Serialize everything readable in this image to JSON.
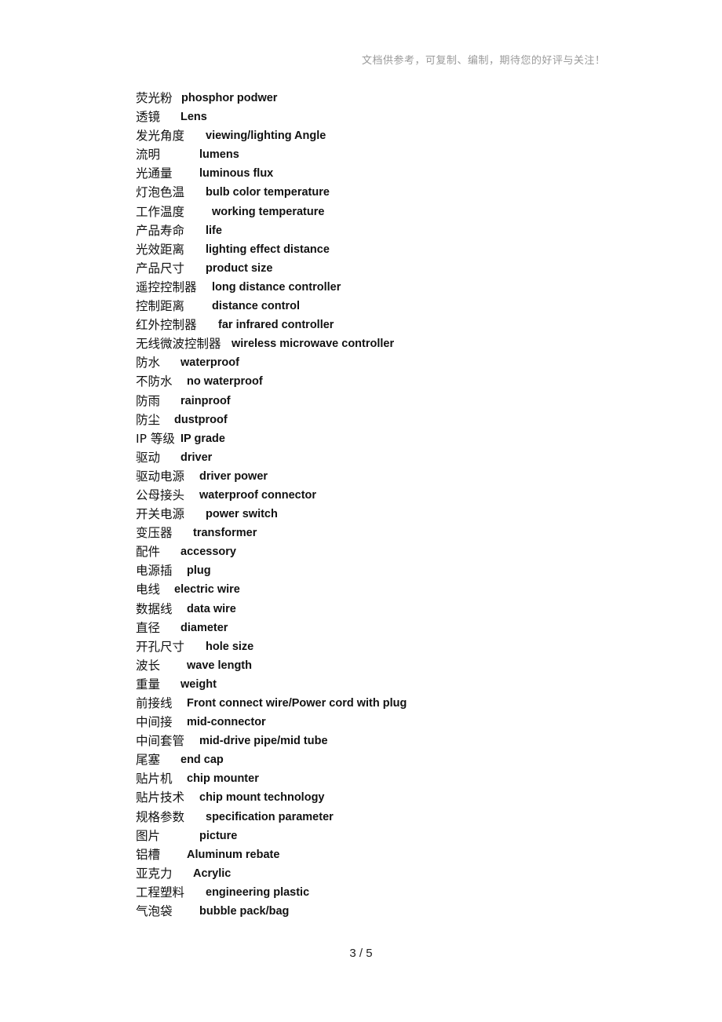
{
  "header_note": "文档供参考，可复制、编制，期待您的好评与关注！",
  "glossary": [
    {
      "zh": "荧光粉",
      "en": "phosphor podwer",
      "gap": 58
    },
    {
      "zh": "透镜",
      "en": "Lens",
      "gap": 57
    },
    {
      "zh": "发光角度",
      "en": "viewing/lighting Angle",
      "gap": 89
    },
    {
      "zh": "流明",
      "en": "lumens",
      "gap": 81
    },
    {
      "zh": "光通量",
      "en": "luminous flux",
      "gap": 81
    },
    {
      "zh": "灯泡色温",
      "en": "bulb color temperature",
      "gap": 89
    },
    {
      "zh": "工作温度",
      "en": "working temperature",
      "gap": 97
    },
    {
      "zh": "产品寿命",
      "en": "life",
      "gap": 89
    },
    {
      "zh": "光效距离",
      "en": "lighting effect distance",
      "gap": 89
    },
    {
      "zh": "产品尺寸",
      "en": "product size",
      "gap": 89
    },
    {
      "zh": "遥控控制器",
      "en": "long distance controller",
      "gap": 97
    },
    {
      "zh": "控制距离",
      "en": "distance control",
      "gap": 97
    },
    {
      "zh": "红外控制器",
      "en": "far infrared controller",
      "gap": 105
    },
    {
      "zh": "无线微波控制器",
      "en": "wireless microwave controller",
      "gap": 122
    },
    {
      "zh": "防水",
      "en": "waterproof",
      "gap": 57
    },
    {
      "zh": "不防水",
      "en": "no waterproof",
      "gap": 65
    },
    {
      "zh": "防雨",
      "en": "rainproof",
      "gap": 57
    },
    {
      "zh": "防尘",
      "en": "dustproof",
      "gap": 49
    },
    {
      "zh": "IP 等级",
      "en": "IP grade",
      "gap": 57
    },
    {
      "zh": "驱动",
      "en": "driver",
      "gap": 57
    },
    {
      "zh": "驱动电源",
      "en": "driver power",
      "gap": 81
    },
    {
      "zh": "公母接头",
      "en": "waterproof connector",
      "gap": 81
    },
    {
      "zh": "开关电源",
      "en": "power switch",
      "gap": 89
    },
    {
      "zh": "变压器",
      "en": "transformer",
      "gap": 73
    },
    {
      "zh": "配件",
      "en": "accessory",
      "gap": 57
    },
    {
      "zh": "电源插",
      "en": "plug",
      "gap": 65
    },
    {
      "zh": "电线",
      "en": "electric wire",
      "gap": 49
    },
    {
      "zh": "数据线",
      "en": "data wire",
      "gap": 65
    },
    {
      "zh": "直径",
      "en": "diameter",
      "gap": 57
    },
    {
      "zh": "开孔尺寸",
      "en": "hole size",
      "gap": 89
    },
    {
      "zh": "波长",
      "en": "wave length",
      "gap": 65
    },
    {
      "zh": "重量",
      "en": "weight",
      "gap": 57
    },
    {
      "zh": "前接线",
      "en": "Front connect wire/Power cord with plug",
      "gap": 65
    },
    {
      "zh": "中间接",
      "en": "mid-connector",
      "gap": 65
    },
    {
      "zh": "中间套管",
      "en": "mid-drive pipe/mid tube",
      "gap": 81
    },
    {
      "zh": "尾塞",
      "en": "end cap",
      "gap": 57
    },
    {
      "zh": "贴片机",
      "en": "chip mounter",
      "gap": 65
    },
    {
      "zh": "贴片技术",
      "en": "chip mount technology",
      "gap": 81
    },
    {
      "zh": "规格参数",
      "en": "specification parameter",
      "gap": 89
    },
    {
      "zh": "图片",
      "en": "picture",
      "gap": 81
    },
    {
      "zh": "铝槽",
      "en": "Aluminum rebate",
      "gap": 65
    },
    {
      "zh": "亚克力",
      "en": "Acrylic",
      "gap": 73
    },
    {
      "zh": "工程塑料",
      "en": "engineering plastic",
      "gap": 89
    },
    {
      "zh": "气泡袋",
      "en": "bubble pack/bag",
      "gap": 81
    }
  ],
  "page_number": "3  / 5"
}
